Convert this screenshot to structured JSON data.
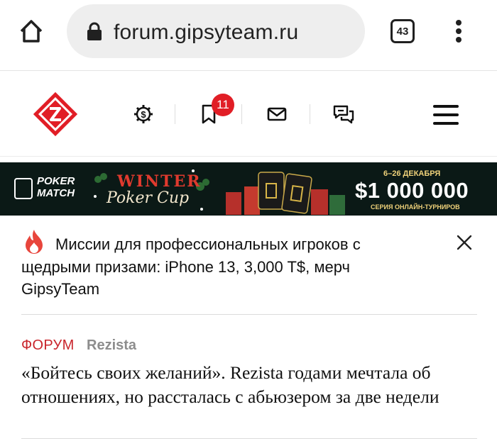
{
  "browser": {
    "url": "forum.gipsyteam.ru",
    "tab_count": "43"
  },
  "header": {
    "logo_icon": "gipsyteam-logo-icon",
    "bookmark_badge": "11"
  },
  "banner": {
    "brand": "POKER MATCH",
    "brand_line1": "POKER",
    "brand_line2": "MATCH",
    "event_title_line1": "WINTER",
    "event_title_line2": "Poker Cup",
    "dates": "6–26 ДЕКАБРЯ",
    "prize": "$1 000 000",
    "subtitle": "СЕРИЯ ОНЛАЙН-ТУРНИРОВ"
  },
  "notice": {
    "icon": "fire-icon",
    "text": "Миссии для профессиональных игроков с щедрыми призами: iPhone 13, 3,000 T$, мерч GipsyTeam"
  },
  "article": {
    "category": "ФОРУМ",
    "author": "Rezista",
    "headline": "«Бойтесь своих желаний». Rezista годами мечтала об отношениях, но рассталась с абьюзером за две недели"
  },
  "colors": {
    "accent_red": "#e11e26",
    "category_red": "#c9252c",
    "author_gray": "#8d8d8d",
    "banner_bg": "#0b1916"
  }
}
